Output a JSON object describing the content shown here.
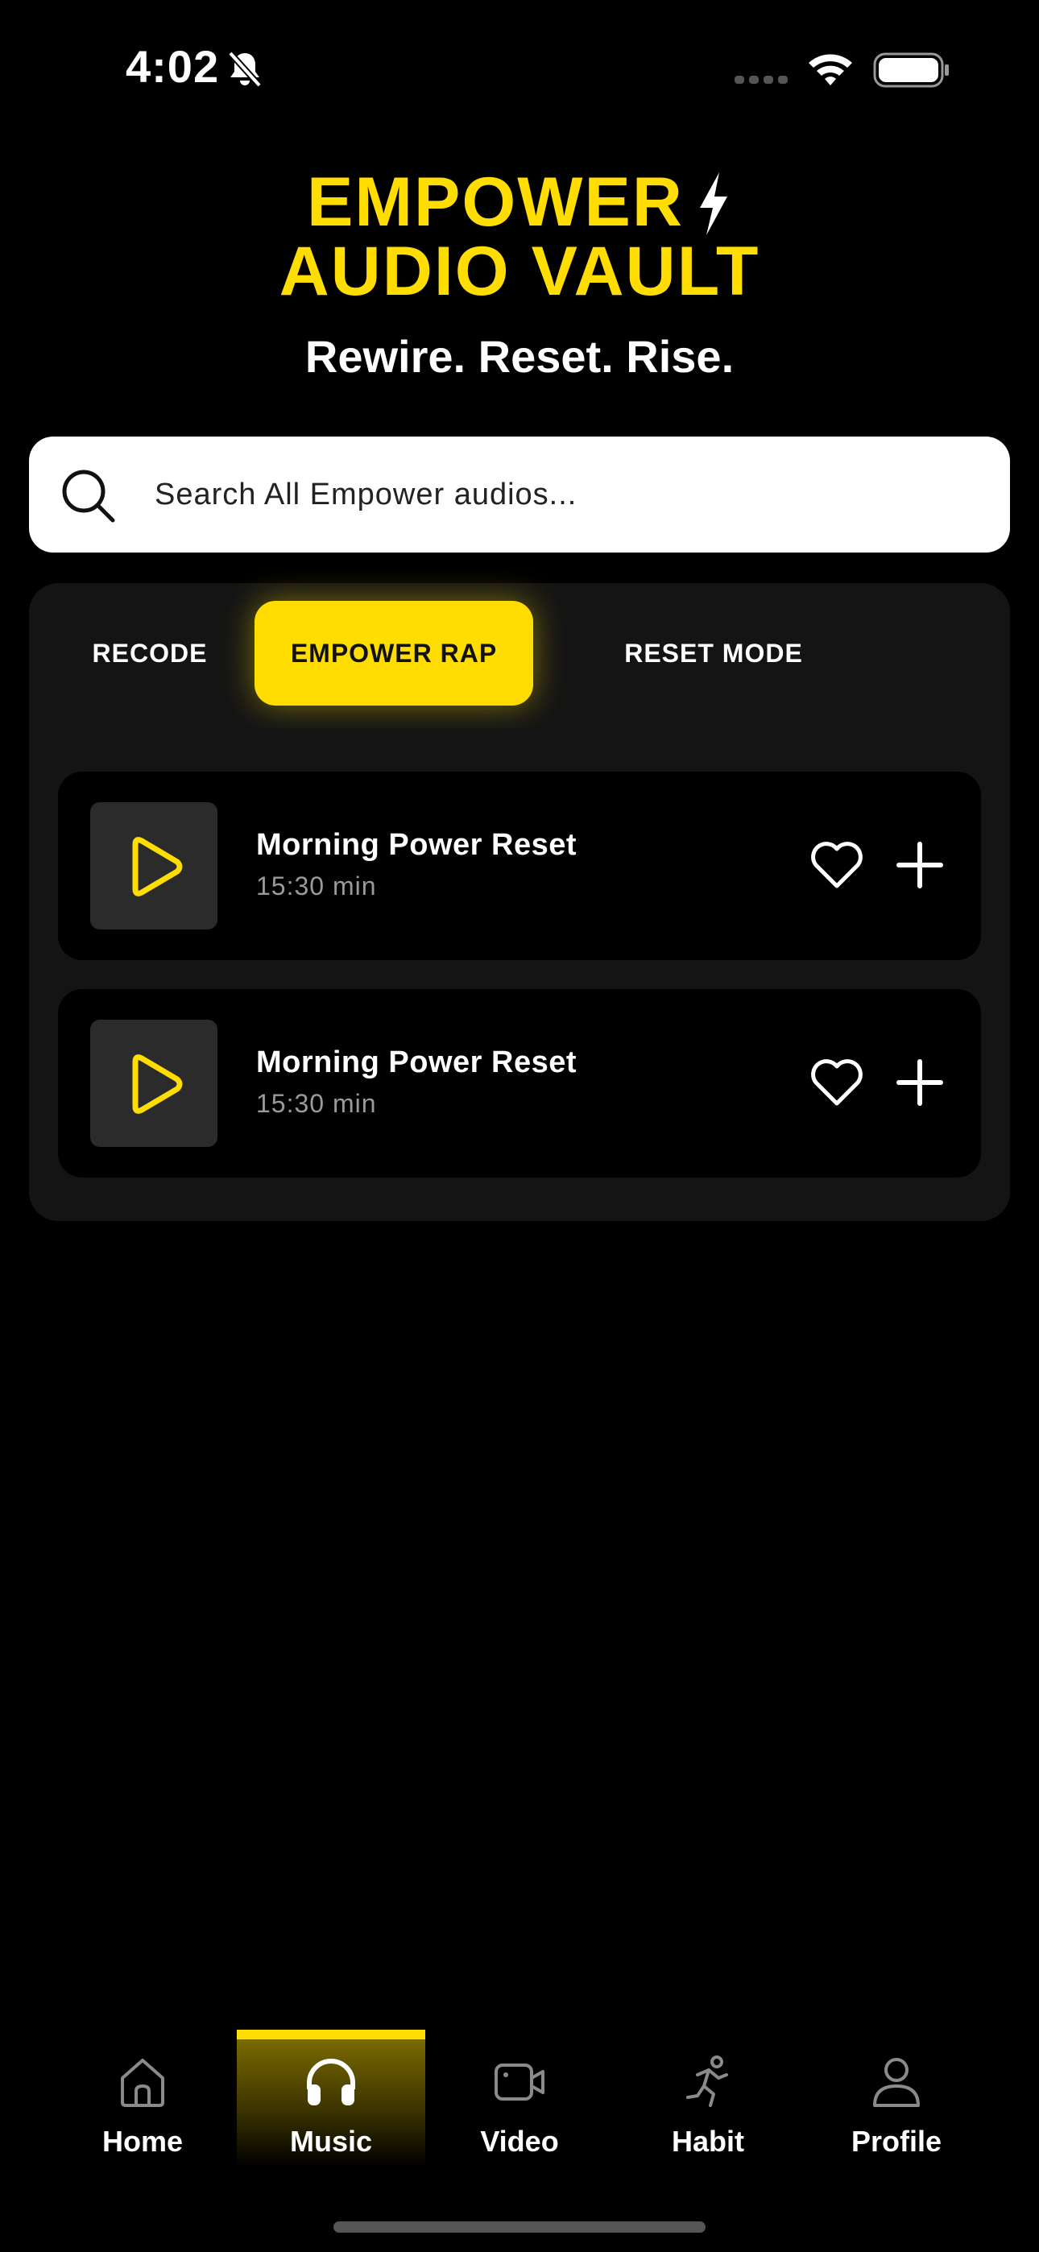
{
  "status_bar": {
    "time": "4:02",
    "icons": [
      "bell-slash-icon",
      "signal-icon",
      "wifi-icon",
      "battery-icon"
    ]
  },
  "header": {
    "title_line1": "EMPOWER",
    "title_line2": "AUDIO VAULT",
    "subtitle": "Rewire. Reset. Rise.",
    "title_icon": "lightning-bolt-icon"
  },
  "search": {
    "placeholder": "Search All Empower audios...",
    "value": ""
  },
  "tabs": [
    {
      "label": "RECODE",
      "active": false
    },
    {
      "label": "EMPOWER RAP",
      "active": true
    },
    {
      "label": "RESET MODE",
      "active": false
    }
  ],
  "tracks": [
    {
      "title": "Morning Power Reset",
      "duration": "15:30 min"
    },
    {
      "title": "Morning Power Reset",
      "duration": "15:30 min"
    }
  ],
  "bottom_nav": [
    {
      "label": "Home",
      "icon": "home-icon",
      "active": false
    },
    {
      "label": "Music",
      "icon": "headphones-icon",
      "active": true
    },
    {
      "label": "Video",
      "icon": "video-camera-icon",
      "active": false
    },
    {
      "label": "Habit",
      "icon": "running-person-icon",
      "active": false
    },
    {
      "label": "Profile",
      "icon": "person-icon",
      "active": false
    }
  ],
  "colors": {
    "accent": "#FFDD00",
    "background": "#000000",
    "panel": "#141414",
    "thumb": "#2B2B2B",
    "muted_text": "#9A9A9A"
  }
}
